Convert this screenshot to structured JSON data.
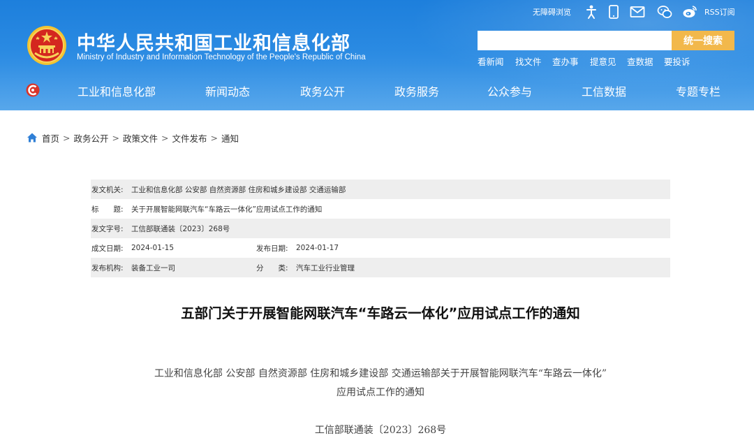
{
  "header": {
    "title_cn": "中华人民共和国工业和信息化部",
    "title_en": "Ministry of Industry and Information Technology of the People's Republic of China",
    "toolbar": {
      "accessibility": "无障碍浏览",
      "rss": "RSS订阅",
      "icons": [
        "accessibility-person-icon",
        "mobile-icon",
        "mail-icon",
        "wechat-icon",
        "weibo-icon",
        "rss-icon"
      ]
    },
    "search": {
      "placeholder": "",
      "button_label": "统一搜索"
    },
    "quick_links": [
      "看新闻",
      "找文件",
      "查办事",
      "提意见",
      "查数据",
      "要投诉"
    ],
    "nav": [
      "工业和信息化部",
      "新闻动态",
      "政务公开",
      "政务服务",
      "公众参与",
      "工信数据",
      "专题专栏"
    ],
    "colors": {
      "header_blue": "#2a8ae2",
      "search_button": "#f2b84b"
    }
  },
  "breadcrumb": [
    "首页",
    "政务公开",
    "政策文件",
    "文件发布",
    "通知"
  ],
  "meta": {
    "issuer_label": "发文机关:",
    "issuer": "工业和信息化部 公安部 自然资源部 住房和城乡建设部 交通运输部",
    "title_label": "标　　题:",
    "title": "关于开展智能网联汽车“车路云一体化”应用试点工作的通知",
    "docno_label": "发文字号:",
    "docno": "工信部联通装〔2023〕268号",
    "written_label": "成文日期:",
    "written": "2024-01-15",
    "published_label": "发布日期:",
    "published": "2024-01-17",
    "org_label": "发布机构:",
    "org": "装备工业一司",
    "category_label": "分　　类:",
    "category": "汽车工业行业管理"
  },
  "document": {
    "heading": "五部门关于开展智能网联汽车“车路云一体化”应用试点工作的通知",
    "subheading_line1": "工业和信息化部 公安部 自然资源部 住房和城乡建设部 交通运输部关于开展智能网联汽车“车路云一体化”",
    "subheading_line2": "应用试点工作的通知",
    "doc_number": "工信部联通装〔2023〕268号"
  }
}
